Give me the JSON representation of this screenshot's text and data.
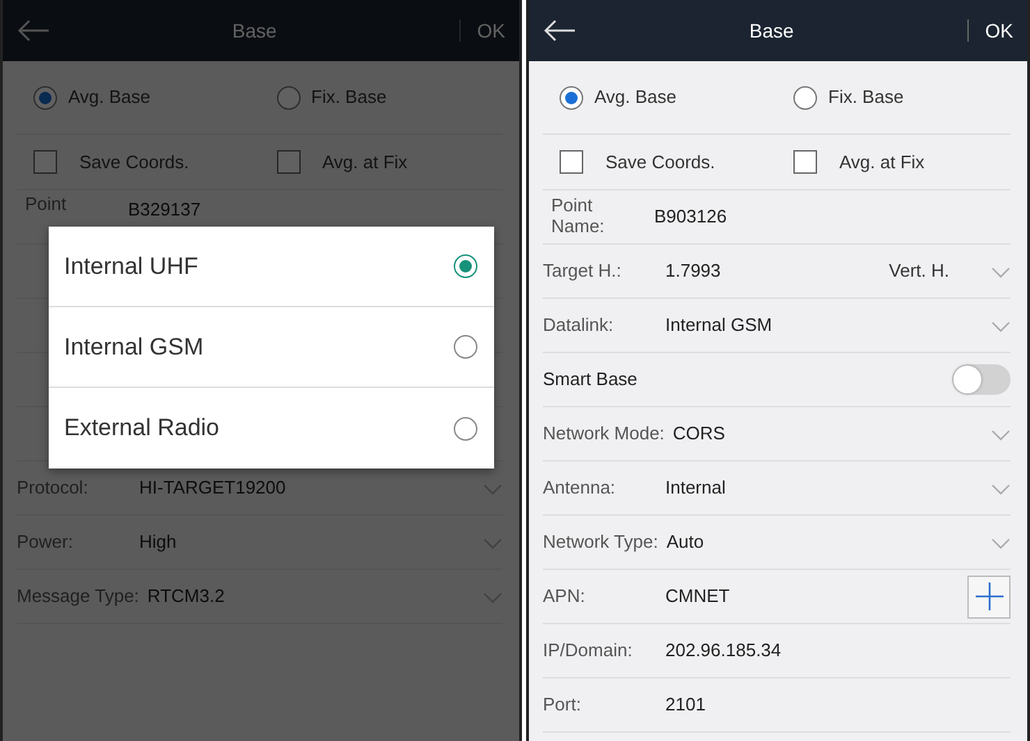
{
  "screens": [
    {
      "header": {
        "title": "Base",
        "action": "OK"
      },
      "dimmed": true,
      "modes": [
        {
          "label": "Avg. Base",
          "selected": true
        },
        {
          "label": "Fix. Base",
          "selected": false
        }
      ],
      "options": [
        {
          "label": "Save Coords.",
          "checked": false
        },
        {
          "label": "Avg. at Fix",
          "checked": false
        }
      ],
      "fields": [
        {
          "kind": "text",
          "label": "Point",
          "value": "B329137"
        },
        {
          "kind": "covered"
        },
        {
          "kind": "covered"
        },
        {
          "kind": "covered"
        },
        {
          "kind": "covered"
        },
        {
          "kind": "select",
          "label": "Protocol:",
          "value": "HI-TARGET19200"
        },
        {
          "kind": "select",
          "label": "Power:",
          "value": "High"
        },
        {
          "kind": "select",
          "label": "Message Type:",
          "value": "RTCM3.2"
        }
      ],
      "dialog": {
        "options": [
          {
            "label": "Internal UHF",
            "selected": true
          },
          {
            "label": "Internal GSM",
            "selected": false
          },
          {
            "label": "External Radio",
            "selected": false
          }
        ]
      }
    },
    {
      "header": {
        "title": "Base",
        "action": "OK"
      },
      "dimmed": false,
      "modes": [
        {
          "label": "Avg. Base",
          "selected": true
        },
        {
          "label": "Fix. Base",
          "selected": false
        }
      ],
      "options": [
        {
          "label": "Save Coords.",
          "checked": false
        },
        {
          "label": "Avg. at Fix",
          "checked": false
        }
      ],
      "fields": [
        {
          "kind": "text",
          "label": "Point Name:",
          "value": "B903126"
        },
        {
          "kind": "select",
          "label": "Target H.:",
          "value": "1.7993",
          "unit": "Vert. H."
        },
        {
          "kind": "select",
          "label": "Datalink:",
          "value": "Internal GSM"
        },
        {
          "kind": "toggle",
          "label": "Smart Base",
          "on": false
        },
        {
          "kind": "select",
          "label": "Network Mode:",
          "value": "CORS"
        },
        {
          "kind": "select",
          "label": "Antenna:",
          "value": "Internal"
        },
        {
          "kind": "select",
          "label": "Network Type:",
          "value": "Auto"
        },
        {
          "kind": "add",
          "label": "APN:",
          "value": "CMNET"
        },
        {
          "kind": "text",
          "label": "IP/Domain:",
          "value": "202.96.185.34"
        },
        {
          "kind": "text",
          "label": "Port:",
          "value": "2101"
        }
      ]
    }
  ]
}
